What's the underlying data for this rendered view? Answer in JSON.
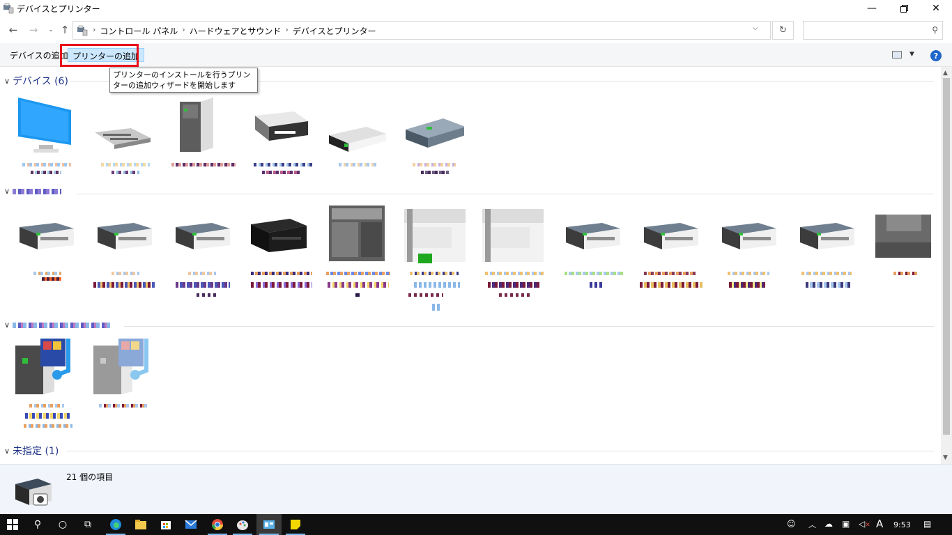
{
  "window": {
    "title": "デバイスとプリンター"
  },
  "address": {
    "breadcrumbs": [
      "コントロール パネル",
      "ハードウェアとサウンド",
      "デバイスとプリンター"
    ],
    "search_placeholder": ""
  },
  "toolbar": {
    "add_device": "デバイスの追加",
    "add_printer": "プリンターの追加"
  },
  "tooltip": {
    "text": "プリンターのインストールを行うプリンターの追加ウィザードを開始します"
  },
  "groups": {
    "devices_label": "デバイス (6)",
    "unspecified_label": "未指定 (1)"
  },
  "details": {
    "count": "21 個の項目"
  },
  "clock": {
    "time": "9:53"
  },
  "tray": {
    "ime": "A"
  },
  "colors": {
    "accent": "#1e3287",
    "highlight": "#e8101c",
    "selection": "#cce8ff",
    "taskbar": "#101010"
  },
  "icons": {
    "app": "devices-printers-icon",
    "back": "back-arrow-icon",
    "forward": "forward-arrow-icon",
    "up": "up-arrow-icon",
    "refresh": "refresh-icon",
    "search": "search-icon",
    "help": "help-icon"
  }
}
